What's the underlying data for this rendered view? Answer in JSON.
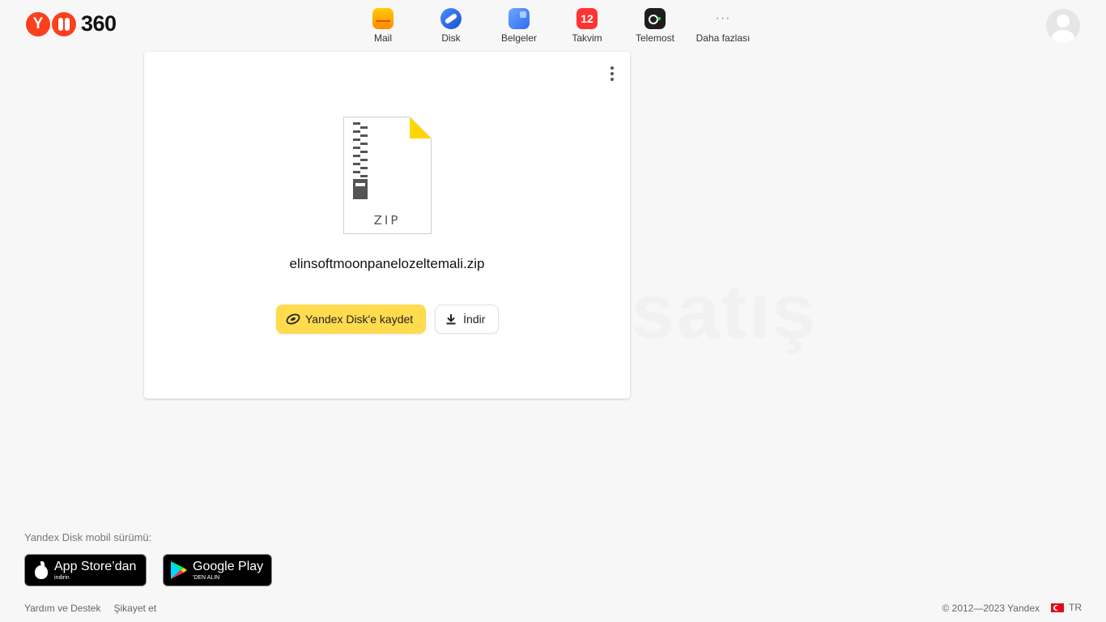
{
  "header": {
    "logo_text": "360",
    "logo_letter": "Y",
    "services": [
      {
        "label": "Mail",
        "icon": "mail-icon"
      },
      {
        "label": "Disk",
        "icon": "disk-icon"
      },
      {
        "label": "Belgeler",
        "icon": "documents-icon"
      },
      {
        "label": "Takvim",
        "icon": "calendar-icon",
        "badge": "12"
      },
      {
        "label": "Telemost",
        "icon": "telemost-icon"
      },
      {
        "label": "Daha fazlası",
        "icon": "more-icon"
      }
    ]
  },
  "file": {
    "type_label": "ZIP",
    "name": "elinsoftmoonpanelozeltemali.zip"
  },
  "actions": {
    "save_label": "Yandex Disk'e kaydet",
    "download_label": "İndir"
  },
  "watermark": "satış",
  "footer": {
    "mobile_label": "Yandex Disk mobil sürümü:",
    "app_store": {
      "big": "App Store’dan",
      "small": "indirin"
    },
    "google_play": {
      "big": "Google Play",
      "small": "'DEN ALIN"
    },
    "links": [
      "Yardım ve Destek",
      "Şikayet et"
    ],
    "copyright": "© 2012—2023 Yandex",
    "lang": "TR"
  },
  "colors": {
    "accent_yellow": "#ffdb4d",
    "brand_red": "#fc3f1d",
    "background": "#f7f7f7"
  }
}
